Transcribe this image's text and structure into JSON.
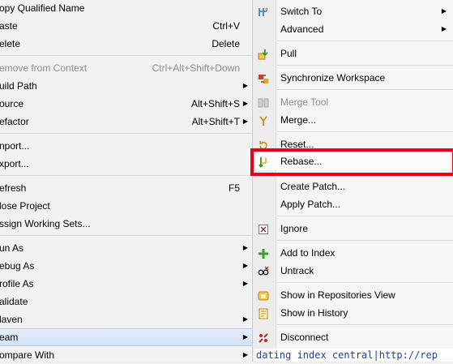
{
  "left_menu": {
    "items": [
      {
        "label": "opy Qualified Name",
        "shortcut": "",
        "submenu": false,
        "disabled": false,
        "highlighted": false
      },
      {
        "label": "aste",
        "shortcut": "Ctrl+V",
        "submenu": false,
        "disabled": false,
        "highlighted": false
      },
      {
        "label": "elete",
        "shortcut": "Delete",
        "submenu": false,
        "disabled": false,
        "highlighted": false
      },
      {
        "label": "emove from Context",
        "shortcut": "Ctrl+Alt+Shift+Down",
        "submenu": false,
        "disabled": true,
        "highlighted": false
      },
      {
        "label": "uild Path",
        "shortcut": "",
        "submenu": true,
        "disabled": false,
        "highlighted": false
      },
      {
        "label": "ource",
        "shortcut": "Alt+Shift+S",
        "submenu": true,
        "disabled": false,
        "highlighted": false
      },
      {
        "label": "efactor",
        "shortcut": "Alt+Shift+T",
        "submenu": true,
        "disabled": false,
        "highlighted": false
      },
      {
        "label": "nport...",
        "shortcut": "",
        "submenu": false,
        "disabled": false,
        "highlighted": false
      },
      {
        "label": "xport...",
        "shortcut": "",
        "submenu": false,
        "disabled": false,
        "highlighted": false
      },
      {
        "label": "efresh",
        "shortcut": "F5",
        "submenu": false,
        "disabled": false,
        "highlighted": false
      },
      {
        "label": "lose Project",
        "shortcut": "",
        "submenu": false,
        "disabled": false,
        "highlighted": false
      },
      {
        "label": "ssign Working Sets...",
        "shortcut": "",
        "submenu": false,
        "disabled": false,
        "highlighted": false
      },
      {
        "label": "un As",
        "shortcut": "",
        "submenu": true,
        "disabled": false,
        "highlighted": false
      },
      {
        "label": "ebug As",
        "shortcut": "",
        "submenu": true,
        "disabled": false,
        "highlighted": false
      },
      {
        "label": "rofile As",
        "shortcut": "",
        "submenu": true,
        "disabled": false,
        "highlighted": false
      },
      {
        "label": "alidate",
        "shortcut": "",
        "submenu": false,
        "disabled": false,
        "highlighted": false
      },
      {
        "label": "laven",
        "shortcut": "",
        "submenu": true,
        "disabled": false,
        "highlighted": false
      },
      {
        "label": "eam",
        "shortcut": "",
        "submenu": true,
        "disabled": false,
        "highlighted": true
      },
      {
        "label": "ompare With",
        "shortcut": "",
        "submenu": true,
        "disabled": false,
        "highlighted": false
      }
    ]
  },
  "right_menu": {
    "items": [
      {
        "label": "Switch To",
        "icon": "switch-branch-icon",
        "submenu": true,
        "disabled": false
      },
      {
        "label": "Advanced",
        "icon": "",
        "submenu": true,
        "disabled": false
      },
      {
        "label": "Pull",
        "icon": "pull-icon",
        "submenu": false,
        "disabled": false
      },
      {
        "label": "Synchronize Workspace",
        "icon": "synchronize-icon",
        "submenu": false,
        "disabled": false
      },
      {
        "label": "Merge Tool",
        "icon": "merge-tool-icon",
        "submenu": false,
        "disabled": true
      },
      {
        "label": "Merge...",
        "icon": "merge-icon",
        "submenu": false,
        "disabled": false
      },
      {
        "label": "Reset...",
        "icon": "reset-icon",
        "submenu": false,
        "disabled": false
      },
      {
        "label": "Rebase...",
        "icon": "rebase-icon",
        "submenu": false,
        "disabled": false
      },
      {
        "label": "Create Patch...",
        "icon": "",
        "submenu": false,
        "disabled": false
      },
      {
        "label": "Apply Patch...",
        "icon": "",
        "submenu": false,
        "disabled": false
      },
      {
        "label": "Ignore",
        "icon": "ignore-icon",
        "submenu": false,
        "disabled": false
      },
      {
        "label": "Add to Index",
        "icon": "add-to-index-icon",
        "submenu": false,
        "disabled": false
      },
      {
        "label": "Untrack",
        "icon": "untrack-icon",
        "submenu": false,
        "disabled": false
      },
      {
        "label": "Show in Repositories View",
        "icon": "repositories-view-icon",
        "submenu": false,
        "disabled": false
      },
      {
        "label": "Show in History",
        "icon": "history-icon",
        "submenu": false,
        "disabled": false
      },
      {
        "label": "Disconnect",
        "icon": "disconnect-icon",
        "submenu": false,
        "disabled": false
      }
    ]
  },
  "annotation": {
    "color": "#e8001c",
    "target": "Rebase..."
  },
  "console": {
    "text": "dating index central|http://rep"
  }
}
